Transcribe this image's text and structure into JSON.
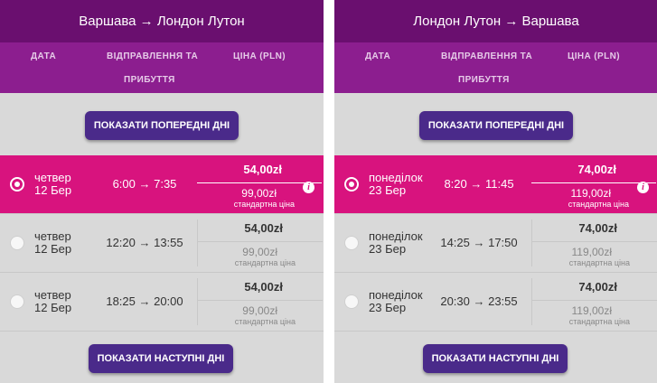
{
  "panels": [
    {
      "route": "Варшава → Лондон Лутон",
      "headers": {
        "date": "ДАТА",
        "departure_line1": "ВІДПРАВЛЕННЯ ТА",
        "departure_line2": "ПРИБУТТЯ",
        "price": "ЦІНА (PLN)"
      },
      "prev_button": "ПОКАЗАТИ ПОПЕРЕДНІ ДНІ",
      "next_button": "ПОКАЗАТИ НАСТУПНІ ДНІ",
      "flights": [
        {
          "day": "четвер",
          "date": "12 Бер",
          "times": "6:00 → 7:35",
          "price": "54,00zł",
          "std_price": "99,00zł",
          "std_label": "стандартна ціна",
          "selected": true,
          "info": "i"
        },
        {
          "day": "четвер",
          "date": "12 Бер",
          "times": "12:20 → 13:55",
          "price": "54,00zł",
          "std_price": "99,00zł",
          "std_label": "стандартна ціна",
          "selected": false
        },
        {
          "day": "четвер",
          "date": "12 Бер",
          "times": "18:25 → 20:00",
          "price": "54,00zł",
          "std_price": "99,00zł",
          "std_label": "стандартна ціна",
          "selected": false
        }
      ]
    },
    {
      "route": "Лондон Лутон → Варшава",
      "headers": {
        "date": "ДАТА",
        "departure_line1": "ВІДПРАВЛЕННЯ ТА",
        "departure_line2": "ПРИБУТТЯ",
        "price": "ЦІНА (PLN)"
      },
      "prev_button": "ПОКАЗАТИ ПОПЕРЕДНІ ДНІ",
      "next_button": "ПОКАЗАТИ НАСТУПНІ ДНІ",
      "flights": [
        {
          "day": "понеділок",
          "date": "23 Бер",
          "times": "8:20 → 11:45",
          "price": "74,00zł",
          "std_price": "119,00zł",
          "std_label": "стандартна ціна",
          "selected": true,
          "info": "i"
        },
        {
          "day": "понеділок",
          "date": "23 Бер",
          "times": "14:25 → 17:50",
          "price": "74,00zł",
          "std_price": "119,00zł",
          "std_label": "стандартна ціна",
          "selected": false
        },
        {
          "day": "понеділок",
          "date": "23 Бер",
          "times": "20:30 → 23:55",
          "price": "74,00zł",
          "std_price": "119,00zł",
          "std_label": "стандартна ціна",
          "selected": false
        }
      ]
    }
  ],
  "colors": {
    "header_dark": "#6a0f6f",
    "header_mid": "#8c1e8f",
    "selected_row": "#d8137e",
    "button": "#4a2a8a",
    "body_bg": "#d9d9d9"
  }
}
